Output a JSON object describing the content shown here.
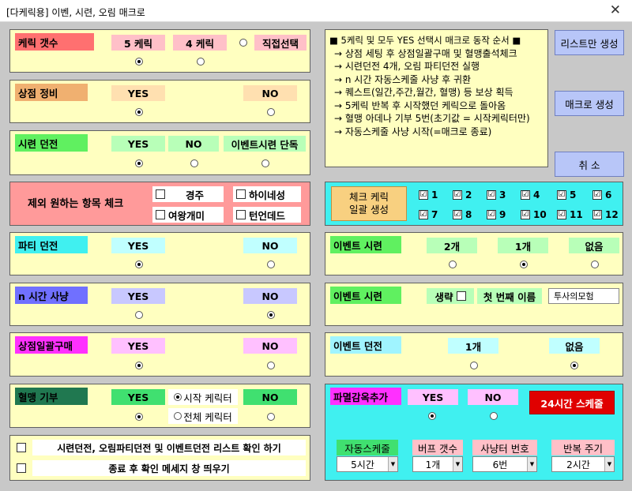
{
  "window": {
    "title": "[다케릭용] 이벤, 시련, 오림 매크로",
    "close": "✕"
  },
  "char_count": {
    "label": "케릭 갯수",
    "opt1": "5 케릭",
    "opt2": "4 케릭",
    "opt3": "직접선택"
  },
  "store": {
    "label": "상점 정비",
    "yes": "YES",
    "no": "NO"
  },
  "trial": {
    "label": "시련 던전",
    "yes": "YES",
    "no": "NO",
    "event_only": "이벤트시련 단독"
  },
  "exclude": {
    "label": "제외 원하는 항목 체크",
    "items": [
      "경주",
      "하이네성",
      "여왕개미",
      "턴언데드"
    ]
  },
  "party": {
    "label": "파티 던전",
    "yes": "YES",
    "no": "NO"
  },
  "nhour": {
    "label": "n 시간 사냥",
    "yes": "YES",
    "no": "NO"
  },
  "bulk": {
    "label": "상점일괄구매",
    "yes": "YES",
    "no": "NO"
  },
  "blood": {
    "label": "혈맹 기부",
    "yes": "YES",
    "start_char": "시작 케릭터",
    "all_char": "전체 케릭터",
    "no": "NO"
  },
  "bottom_checks": {
    "list_check": "시련던전, 오림파티던전 및 이벤트던전 리스트 확인 하기",
    "exit_msg": "종료 후 확인 메세지 창 띄우기"
  },
  "info": {
    "lines": [
      "■ 5케릭 및 모두 YES 선택시 매크로 동작 순서  ■",
      "→ 상점 세팅 후 상점일괄구매 및 혈맹출석체크",
      "→ 시련던전 4개, 오림 파티던전 실행",
      "→ n 시간 자동스케줄 사냥 후 귀환",
      "→ 퀘스트(일간,주간,월간, 혈맹) 등 보상 획득",
      "→ 5케릭 반복 후 시작했던 케릭으로 돌아옴",
      "→ 혈맹 아데나 기부 5번(초기값 = 시작케릭터만)",
      "→ 자동스케줄 사냥 시작(=매크로 종료)"
    ]
  },
  "buttons": {
    "list_only": "리스트만 생성",
    "macro": "매크로 생성",
    "cancel": "취   소"
  },
  "check_chars": {
    "button": "체크 케릭\n일괄 생성",
    "nums": [
      "1",
      "2",
      "3",
      "4",
      "5",
      "6",
      "7",
      "8",
      "9",
      "10",
      "11",
      "12"
    ]
  },
  "event_trial1": {
    "label": "이벤트 시련",
    "opt1": "2개",
    "opt2": "1개",
    "opt3": "없음"
  },
  "event_trial2": {
    "label": "이벤트 시련",
    "omit": "생략",
    "first_name": "첫 번째 이름",
    "name_value": "투사의모험"
  },
  "event_dungeon": {
    "label": "이벤트 던전",
    "opt1": "1개",
    "opt2": "없음"
  },
  "prison": {
    "label": "파멸감옥추가",
    "yes": "YES",
    "no": "NO",
    "schedule_btn": "24시간 스케줄"
  },
  "auto": {
    "auto_label": "자동스케줄",
    "auto_value": "5시간",
    "buff_label": "버프 갯수",
    "buff_value": "1개",
    "hunter_label": "사냥터 번호",
    "hunter_value": "6번",
    "repeat_label": "반복 주기",
    "repeat_value": "2시간"
  },
  "colors": {
    "yellow": "#ffffc0",
    "pink": "#ff9a9a",
    "cyan": "#40f0f0",
    "accent_red": "#e00000"
  }
}
